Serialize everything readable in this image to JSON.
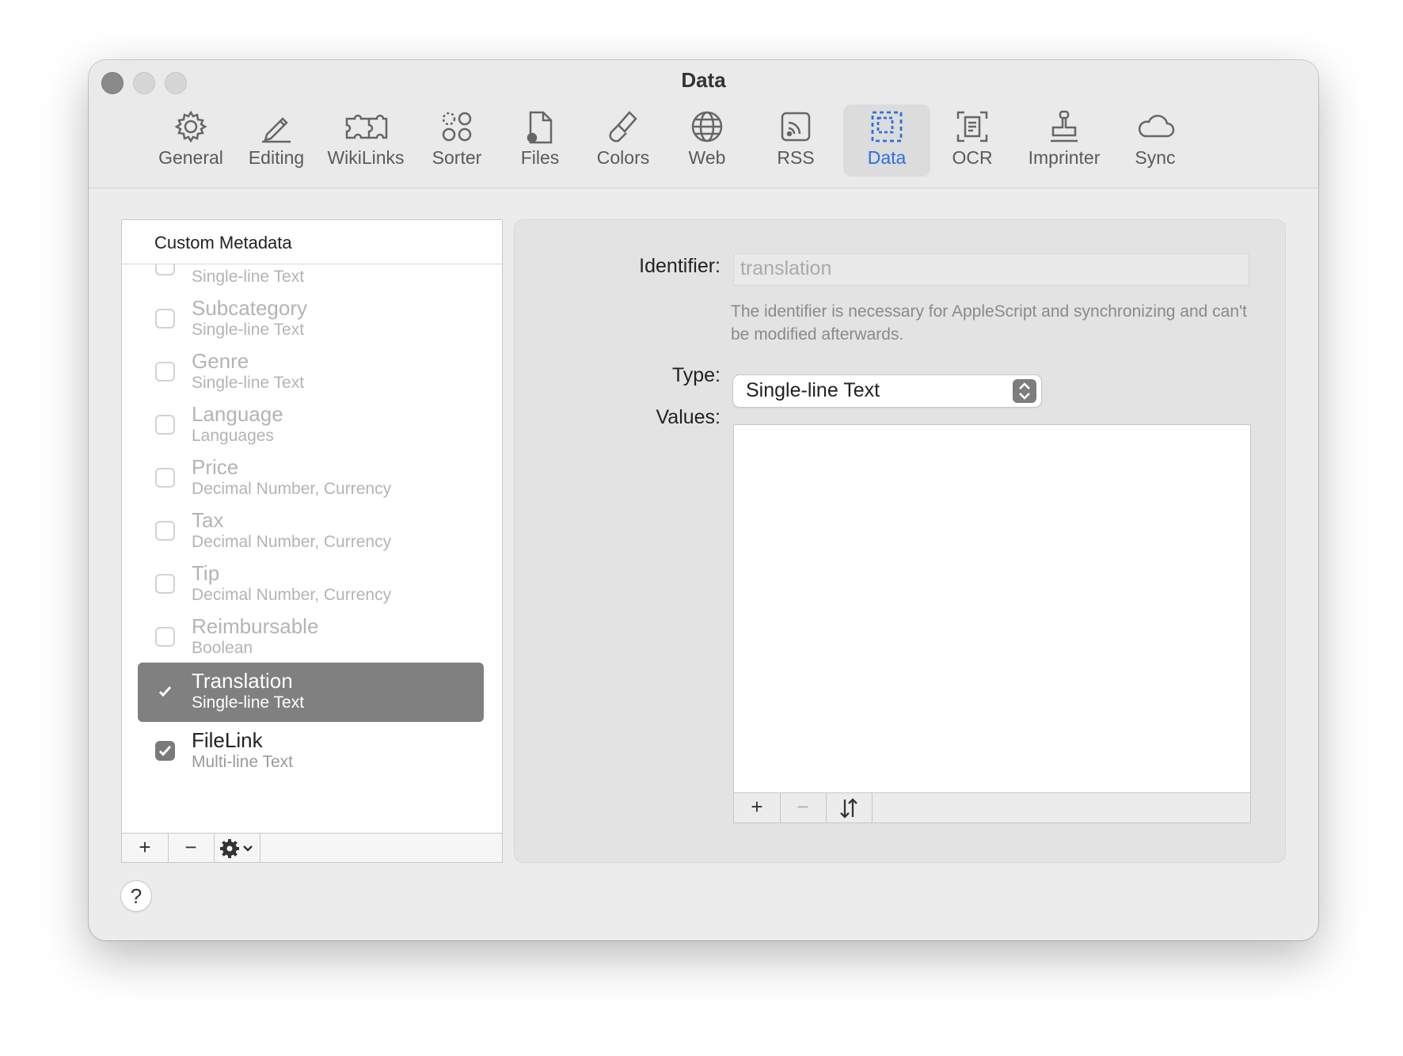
{
  "window": {
    "title": "Data"
  },
  "toolbar": [
    {
      "label": "General",
      "icon": "gear-icon"
    },
    {
      "label": "Editing",
      "icon": "pencil-icon"
    },
    {
      "label": "WikiLinks",
      "icon": "puzzle-icon"
    },
    {
      "label": "Sorter",
      "icon": "sorter-icon"
    },
    {
      "label": "Files",
      "icon": "files-icon"
    },
    {
      "label": "Colors",
      "icon": "paintbrush-icon"
    },
    {
      "label": "Web",
      "icon": "globe-icon"
    },
    {
      "label": "RSS",
      "icon": "rss-icon"
    },
    {
      "label": "Data",
      "icon": "data-icon",
      "active": true
    },
    {
      "label": "OCR",
      "icon": "ocr-icon"
    },
    {
      "label": "Imprinter",
      "icon": "stamp-icon"
    },
    {
      "label": "Sync",
      "icon": "cloud-icon"
    }
  ],
  "list": {
    "header": "Custom Metadata",
    "items": [
      {
        "name": "",
        "type": "Single-line Text",
        "checked": false
      },
      {
        "name": "Subcategory",
        "type": "Single-line Text",
        "checked": false
      },
      {
        "name": "Genre",
        "type": "Single-line Text",
        "checked": false
      },
      {
        "name": "Language",
        "type": "Languages",
        "checked": false
      },
      {
        "name": "Price",
        "type": "Decimal Number, Currency",
        "checked": false
      },
      {
        "name": "Tax",
        "type": "Decimal Number, Currency",
        "checked": false
      },
      {
        "name": "Tip",
        "type": "Decimal Number, Currency",
        "checked": false
      },
      {
        "name": "Reimbursable",
        "type": "Boolean",
        "checked": false
      },
      {
        "name": "Translation",
        "type": "Single-line Text",
        "checked": true,
        "selected": true
      },
      {
        "name": "FileLink",
        "type": "Multi-line Text",
        "checked": true
      }
    ],
    "buttons": {
      "add": "+",
      "remove": "−"
    }
  },
  "detail": {
    "identifier_label": "Identifier:",
    "identifier_value": "translation",
    "help": "The identifier is necessary for AppleScript and synchronizing and can't be modified afterwards.",
    "type_label": "Type:",
    "type_value": "Single-line Text",
    "values_label": "Values:",
    "values_buttons": {
      "add": "+",
      "remove": "−"
    }
  },
  "help_button": "?",
  "colors": {
    "accent": "#2a6fe0",
    "selection": "#808080"
  }
}
